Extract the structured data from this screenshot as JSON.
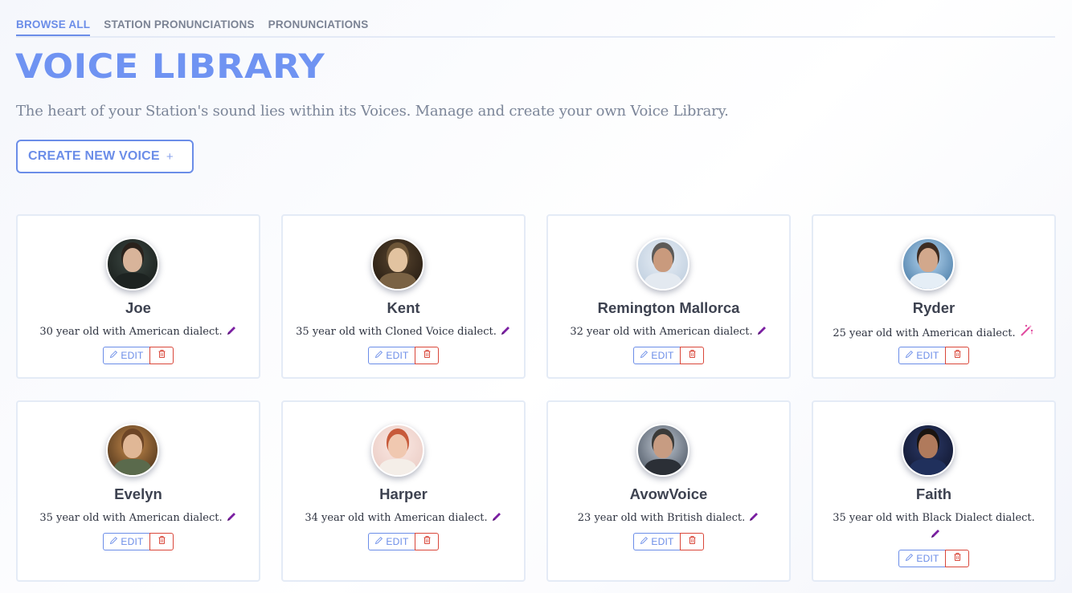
{
  "tabs": [
    {
      "label": "BROWSE ALL",
      "active": true
    },
    {
      "label": "STATION PRONUNCIATIONS",
      "active": false
    },
    {
      "label": "PRONUNCIATIONS",
      "active": false
    }
  ],
  "header": {
    "title": "VOICE LIBRARY",
    "subtitle": "The heart of your Station's sound lies within its Voices. Manage and create your own Voice Library."
  },
  "create_button": {
    "label": "CREATE NEW VOICE",
    "icon": "plus-icon"
  },
  "voices": [
    {
      "name": "Joe",
      "description": "30 year old with American dialect.",
      "edit_label": "EDIT",
      "badge_icon": "pencil-icon"
    },
    {
      "name": "Kent",
      "description": "35 year old with Cloned Voice dialect.",
      "edit_label": "EDIT",
      "badge_icon": "pencil-icon"
    },
    {
      "name": "Remington Mallorca",
      "description": "32 year old with American dialect.",
      "edit_label": "EDIT",
      "badge_icon": "pencil-icon"
    },
    {
      "name": "Ryder",
      "description": "25 year old with American dialect.",
      "edit_label": "EDIT",
      "badge_icon": "magic-wand-icon"
    },
    {
      "name": "Evelyn",
      "description": "35 year old with American dialect.",
      "edit_label": "EDIT",
      "badge_icon": "pencil-icon"
    },
    {
      "name": "Harper",
      "description": "34 year old with American dialect.",
      "edit_label": "EDIT",
      "badge_icon": "pencil-icon"
    },
    {
      "name": "AvowVoice",
      "description": "23 year old with British dialect.",
      "edit_label": "EDIT",
      "badge_icon": "pencil-icon"
    },
    {
      "name": "Faith",
      "description": "35 year old with Black Dialect dialect.",
      "edit_label": "EDIT",
      "badge_icon": "pencil-icon"
    }
  ],
  "colors": {
    "accent": "#6b8de8",
    "title": "#6f93f2",
    "delete": "#d9473a",
    "pencil": "#7b1fa2",
    "magic": "#e04ca0"
  }
}
